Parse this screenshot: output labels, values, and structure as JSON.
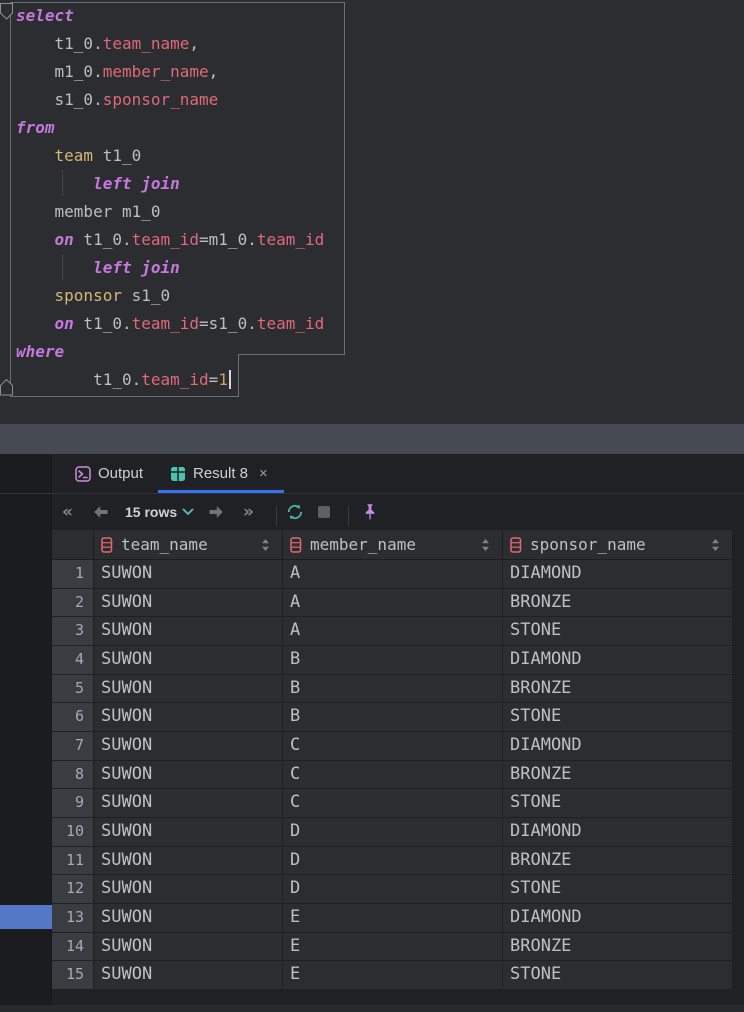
{
  "editor": {
    "lines": [
      {
        "segments": [
          {
            "text": "select",
            "style": "keyword"
          }
        ]
      },
      {
        "segments": [
          {
            "text": "    t1_0.",
            "style": "plain"
          },
          {
            "text": "team_name",
            "style": "column"
          },
          {
            "text": ",",
            "style": "plain"
          }
        ]
      },
      {
        "segments": [
          {
            "text": "    m1_0.",
            "style": "plain"
          },
          {
            "text": "member_name",
            "style": "column"
          },
          {
            "text": ",",
            "style": "plain"
          }
        ]
      },
      {
        "segments": [
          {
            "text": "    s1_0.",
            "style": "plain"
          },
          {
            "text": "sponsor_name",
            "style": "column"
          }
        ]
      },
      {
        "segments": [
          {
            "text": "from",
            "style": "keyword"
          }
        ]
      },
      {
        "segments": [
          {
            "text": "    ",
            "style": "plain"
          },
          {
            "text": "team",
            "style": "table"
          },
          {
            "text": " t1_0",
            "style": "plain"
          }
        ]
      },
      {
        "segments": [
          {
            "text": "        ",
            "style": "plain"
          },
          {
            "text": "left join",
            "style": "keyword"
          }
        ]
      },
      {
        "segments": [
          {
            "text": "    member m1_0",
            "style": "plain"
          }
        ]
      },
      {
        "segments": [
          {
            "text": "    ",
            "style": "plain"
          },
          {
            "text": "on",
            "style": "keyword"
          },
          {
            "text": " t1_0.",
            "style": "plain"
          },
          {
            "text": "team_id",
            "style": "column"
          },
          {
            "text": "=m1_0.",
            "style": "plain"
          },
          {
            "text": "team_id",
            "style": "column"
          }
        ]
      },
      {
        "segments": [
          {
            "text": "        ",
            "style": "plain"
          },
          {
            "text": "left join",
            "style": "keyword"
          }
        ]
      },
      {
        "segments": [
          {
            "text": "    ",
            "style": "plain"
          },
          {
            "text": "sponsor",
            "style": "table"
          },
          {
            "text": " s1_0",
            "style": "plain"
          }
        ]
      },
      {
        "segments": [
          {
            "text": "    ",
            "style": "plain"
          },
          {
            "text": "on",
            "style": "keyword"
          },
          {
            "text": " t1_0.",
            "style": "plain"
          },
          {
            "text": "team_id",
            "style": "column"
          },
          {
            "text": "=s1_0.",
            "style": "plain"
          },
          {
            "text": "team_id",
            "style": "column"
          }
        ]
      },
      {
        "segments": [
          {
            "text": "where",
            "style": "keyword"
          }
        ]
      },
      {
        "segments": [
          {
            "text": "        t1_0.",
            "style": "plain"
          },
          {
            "text": "team_id",
            "style": "column"
          },
          {
            "text": "=",
            "style": "plain"
          },
          {
            "text": "1",
            "style": "number"
          }
        ],
        "caret": true
      }
    ]
  },
  "tabs": {
    "output": {
      "label": "Output",
      "icon": "terminal-icon"
    },
    "result": {
      "label": "Result 8",
      "icon": "table-grid-icon",
      "close": "×",
      "active": true
    }
  },
  "toolbar": {
    "first": "«",
    "last": "»",
    "page_size": "15 rows",
    "icons": [
      "first-page",
      "previous-page",
      "page-size-dropdown",
      "next-page",
      "last-page",
      "refresh",
      "stop",
      "pin"
    ]
  },
  "results": {
    "columns": [
      "team_name",
      "member_name",
      "sponsor_name"
    ],
    "rows": [
      [
        "1",
        "SUWON",
        "A",
        "DIAMOND"
      ],
      [
        "2",
        "SUWON",
        "A",
        "BRONZE"
      ],
      [
        "3",
        "SUWON",
        "A",
        "STONE"
      ],
      [
        "4",
        "SUWON",
        "B",
        "DIAMOND"
      ],
      [
        "5",
        "SUWON",
        "B",
        "BRONZE"
      ],
      [
        "6",
        "SUWON",
        "B",
        "STONE"
      ],
      [
        "7",
        "SUWON",
        "C",
        "DIAMOND"
      ],
      [
        "8",
        "SUWON",
        "C",
        "BRONZE"
      ],
      [
        "9",
        "SUWON",
        "C",
        "STONE"
      ],
      [
        "10",
        "SUWON",
        "D",
        "DIAMOND"
      ],
      [
        "11",
        "SUWON",
        "D",
        "BRONZE"
      ],
      [
        "12",
        "SUWON",
        "D",
        "STONE"
      ],
      [
        "13",
        "SUWON",
        "E",
        "DIAMOND"
      ],
      [
        "14",
        "SUWON",
        "E",
        "BRONZE"
      ],
      [
        "15",
        "SUWON",
        "E",
        "STONE"
      ]
    ]
  },
  "colors": {
    "editor_bg": "#2b2d30",
    "panel_bg": "#1f2125",
    "accent_blue": "#3574f0",
    "keyword_purple": "#c678dd",
    "column_red": "#e0697a",
    "table_yellow": "#d5b778",
    "result_tab_teal": "#4cc3ad",
    "output_tab_purple": "#cb8de0",
    "refresh_teal": "#4db6ac",
    "pin_purple": "#c78be4",
    "header_icon_red": "#e0696f",
    "rail_marker_blue": "#5577c8"
  }
}
